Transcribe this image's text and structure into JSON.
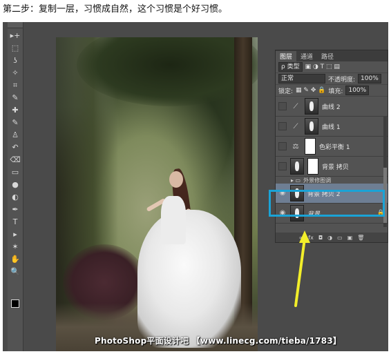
{
  "caption": "第二步：复制一层，习惯成自然，这个习惯是个好习惯。",
  "toolbar": {
    "tools": [
      "move-icon",
      "marquee-icon",
      "lasso-icon",
      "magic-wand-icon",
      "crop-icon",
      "eyedropper-icon",
      "healing-brush-icon",
      "brush-icon",
      "clone-stamp-icon",
      "history-brush-icon",
      "eraser-icon",
      "gradient-icon",
      "blur-icon",
      "dodge-icon",
      "pen-icon",
      "type-icon",
      "path-selection-icon",
      "shape-icon",
      "hand-icon",
      "zoom-icon"
    ],
    "glyphs": [
      "▸+",
      "⬚",
      "ʖ",
      "✧",
      "⌗",
      "✎",
      "✚",
      "✎",
      "♙",
      "↶",
      "⌫",
      "▭",
      "●",
      "◐",
      "✒",
      "T",
      "▸",
      "✶",
      "✋",
      "🔍"
    ]
  },
  "watermark": "PhotoShop平面设计吧 【www.linecg.com/tieba/1783】",
  "layers_panel": {
    "tabs": [
      "图层",
      "通道",
      "路径"
    ],
    "filter_label": "ρ 类型",
    "blend_mode": "正常",
    "opacity_label": "不透明度:",
    "opacity_value": "100%",
    "lock_label": "锁定:",
    "fill_label": "填充:",
    "fill_value": "100%",
    "layers": [
      {
        "name": "曲线 2",
        "type": "adjustment"
      },
      {
        "name": "曲线 1",
        "type": "adjustment"
      },
      {
        "name": "色彩平衡 1",
        "type": "adjustment"
      },
      {
        "name": "背景 拷贝",
        "type": "pixel"
      }
    ],
    "group_name": "外景修图调",
    "selected_layer": "背景 拷贝 2",
    "background_layer": "背景"
  },
  "colors": {
    "highlight": "#1aa3d6",
    "arrow": "#f2ee2a",
    "selected_layer_bg": "#6e7e93"
  }
}
